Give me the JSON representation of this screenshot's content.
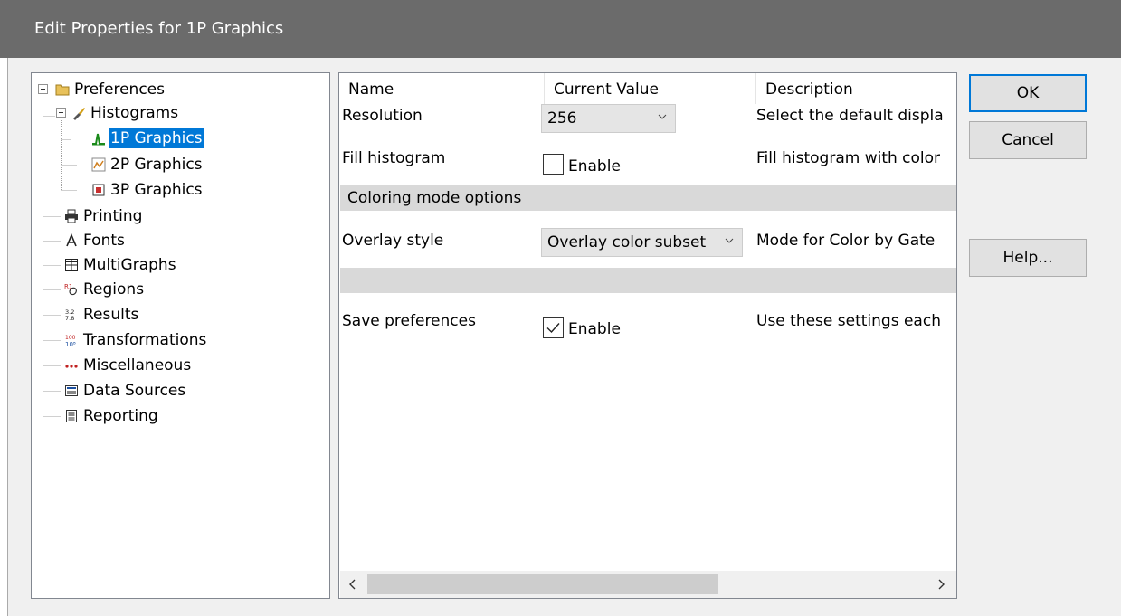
{
  "window": {
    "title": "Edit Properties for 1P Graphics"
  },
  "tree": {
    "root": {
      "label": "Preferences",
      "icon": "folder-icon"
    },
    "histograms": {
      "label": "Histograms",
      "icon": "histogram-brush-icon"
    },
    "items": [
      {
        "label": "1P Graphics",
        "icon": "histogram-1p-icon",
        "selected": true
      },
      {
        "label": "2P Graphics",
        "icon": "histogram-2p-icon"
      },
      {
        "label": "3P Graphics",
        "icon": "histogram-3p-icon"
      }
    ],
    "top_items": [
      {
        "label": "Printing",
        "icon": "printer-icon"
      },
      {
        "label": "Fonts",
        "icon": "font-icon"
      },
      {
        "label": "MultiGraphs",
        "icon": "multigraph-icon"
      },
      {
        "label": "Regions",
        "icon": "regions-icon"
      },
      {
        "label": "Results",
        "icon": "results-icon"
      },
      {
        "label": "Transformations",
        "icon": "transformations-icon"
      },
      {
        "label": "Miscellaneous",
        "icon": "miscellaneous-icon"
      },
      {
        "label": "Data Sources",
        "icon": "data-sources-icon"
      },
      {
        "label": "Reporting",
        "icon": "reporting-icon"
      }
    ]
  },
  "grid": {
    "headers": {
      "name": "Name",
      "value": "Current Value",
      "description": "Description"
    },
    "rows": {
      "resolution": {
        "name": "Resolution",
        "value": "256",
        "description": "Select the default displa"
      },
      "fill": {
        "name": "Fill histogram",
        "checkbox_label": "Enable",
        "checked": false,
        "description": "Fill histogram with color"
      },
      "section": "Coloring mode options",
      "overlay": {
        "name": "Overlay style",
        "value": "Overlay color subset",
        "description": "Mode for Color by Gate"
      },
      "save": {
        "name": "Save preferences",
        "checkbox_label": "Enable",
        "checked": true,
        "description": "Use these settings each"
      }
    }
  },
  "buttons": {
    "ok": "OK",
    "cancel": "Cancel",
    "help": "Help..."
  },
  "colors": {
    "titlebar": "#6b6b6b",
    "selection": "#0078d7",
    "section_bg": "#d9d9d9"
  }
}
